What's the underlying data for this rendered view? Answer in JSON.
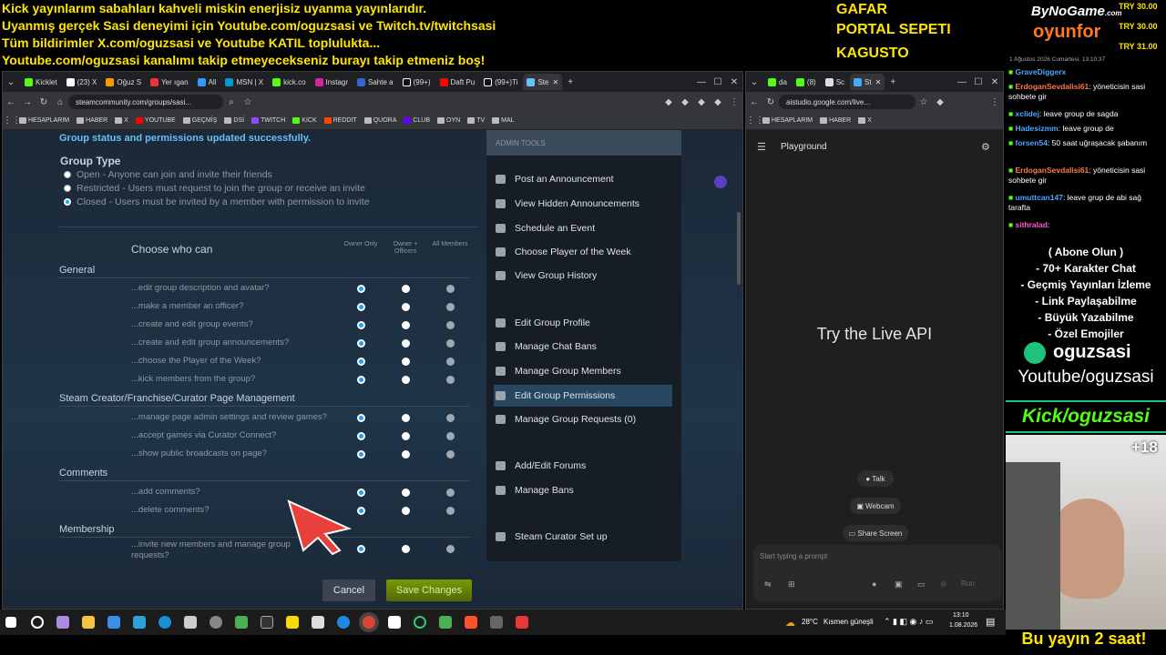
{
  "banner": {
    "lines": [
      "Kick yayınlarım sabahları kahveli miskin enerjisiz uyanma yayınlarıdır.",
      "Uyanmış gerçek Sasi deneyimi için Youtube.com/oguzsasi ve Twitch.tv/twitchsasi",
      "Tüm bildirimler X.com/oguzsasi ve Youtube KATIL toplulukta...",
      "Youtube.com/oguzsasi kanalımı takip etmeyecekseniz burayı takip etmeniz boş!"
    ],
    "promo": [
      "GAFAR",
      "PORTAL SEPETI",
      "KAGUSTO"
    ]
  },
  "left_browser": {
    "tabs": [
      "Kicklet",
      "(23) X",
      "Oğuz S",
      "Yer ıgan",
      "All",
      "MSN | X",
      "kick.co",
      "Instagr",
      "Sahte a",
      "(99+)",
      "Daft Pu",
      "(99+)Ti",
      "Ste"
    ],
    "url": "steamcommunity.com/groups/sasi...",
    "bookmarks": [
      "HESAPLARIM",
      "HABER",
      "X",
      "YOUTUBE",
      "GEÇMİŞ",
      "DSİ",
      "TWITCH",
      "KICK",
      "REDDIT",
      "QUORA",
      "CLUB",
      "OYN",
      "TV",
      "MAL"
    ]
  },
  "steam": {
    "status_message": "Group status and permissions updated successfully.",
    "group_type_title": "Group Type",
    "group_type_options": [
      {
        "label": "Open - Anyone can join and invite their friends",
        "selected": false
      },
      {
        "label": "Restricted - Users must request to join the group or receive an invite",
        "selected": false
      },
      {
        "label": "Closed - Users must be invited by a member with permission to invite",
        "selected": true
      }
    ],
    "choose_title": "Choose who can",
    "columns": [
      "Owner Only",
      "Owner + Officers",
      "All Members"
    ],
    "sections": [
      {
        "title": "General",
        "perms": [
          {
            "label": "...edit group description and avatar?",
            "sel": 0
          },
          {
            "label": "...make a member an officer?",
            "sel": 0
          },
          {
            "label": "...create and edit group events?",
            "sel": 0
          },
          {
            "label": "...create and edit group announcements?",
            "sel": 0
          },
          {
            "label": "...choose the Player of the Week?",
            "sel": 0
          },
          {
            "label": "...kick members from the group?",
            "sel": 0
          }
        ]
      },
      {
        "title": "Steam Creator/Franchise/Curator Page Management",
        "perms": [
          {
            "label": "...manage page admin settings and review games?",
            "sel": 0
          },
          {
            "label": "...accept games via Curator Connect?",
            "sel": 0
          },
          {
            "label": "...show public broadcasts on page?",
            "sel": 0
          }
        ]
      },
      {
        "title": "Comments",
        "perms": [
          {
            "label": "...add comments?",
            "sel": 0
          },
          {
            "label": "...delete comments?",
            "sel": 0
          }
        ]
      },
      {
        "title": "Membership",
        "perms": [
          {
            "label": "...invite new members and manage group requests?",
            "sel": 0
          }
        ]
      }
    ],
    "cancel_label": "Cancel",
    "save_label": "Save Changes",
    "admin_title": "ADMIN TOOLS",
    "admin_items": [
      "Post an Announcement",
      "View Hidden Announcements",
      "Schedule an Event",
      "Choose Player of the Week",
      "View Group History",
      "Edit Group Profile",
      "Manage Chat Bans",
      "Manage Group Members",
      "Edit Group Permissions",
      "Manage Group Requests (0)",
      "Add/Edit Forums",
      "Manage Bans",
      "Steam Curator Set up"
    ],
    "admin_active": "Edit Group Permissions"
  },
  "right_browser": {
    "tabs": [
      "da",
      "(8)",
      "Sc",
      "St"
    ],
    "url": "aistudio.google.com/live...",
    "bookmarks": [
      "HESAPLARIM",
      "HABER",
      "X"
    ],
    "panel_title": "Playground",
    "headline": "Try the Live API",
    "talk_label": "Talk",
    "webcam_label": "Webcam",
    "share_label": "Share Screen",
    "prompt_placeholder": "Start typing a prompt",
    "run_label": "Run"
  },
  "overlay": {
    "brand1": "ByNoGame",
    "brand1_suffix": ".com",
    "brand2": "oyunfor",
    "prices": [
      "TRY 30.00",
      "TRY 30.00",
      "TRY 31.00"
    ],
    "chat_timestamp": "1 Ağustos 2026 Cumartesi, 13:10:37",
    "chat": [
      {
        "user": "GraveDiggerx",
        "msg": "",
        "color": "u"
      },
      {
        "user": "ErdoganSevdalisi61",
        "msg": ": yöneticisin sasi sohbete gir",
        "color": "u2"
      },
      {
        "user": "xclidej",
        "msg": ": leave group de sagda",
        "color": "u"
      },
      {
        "user": "Hadesizmm",
        "msg": ": leave group de",
        "color": "u"
      },
      {
        "user": "forsen54",
        "msg": ": 50 saat uğraşacak şabanım",
        "color": "u"
      },
      {
        "user": "ErdoganSevdalisi61",
        "msg": ": yöneticisin sasi sohbete gir",
        "color": "u2"
      },
      {
        "user": "umuttcan147",
        "msg": ": leave grup de abi sağ tarafta",
        "color": "u"
      },
      {
        "user": "sithralad",
        "msg": ":",
        "color": "u3"
      }
    ],
    "promo_lines": [
      "( Abone Olun )",
      "- 70+ Karakter Chat",
      "- Geçmiş Yayınları İzleme",
      "- Link Paylaşabilme",
      "- Büyük Yazabilme",
      "- Özel Emojiler"
    ],
    "handle": "oguzsasi",
    "youtube": "Youtube/oguzsasi",
    "kick": "Kick/oguzsasi",
    "age": "+18",
    "bottom": "Bu yayın 2 saat!"
  },
  "taskbar": {
    "weather": "28°C",
    "weather_text": "Kısmen güneşli",
    "time": "13:10",
    "date": "1.08.2026"
  }
}
